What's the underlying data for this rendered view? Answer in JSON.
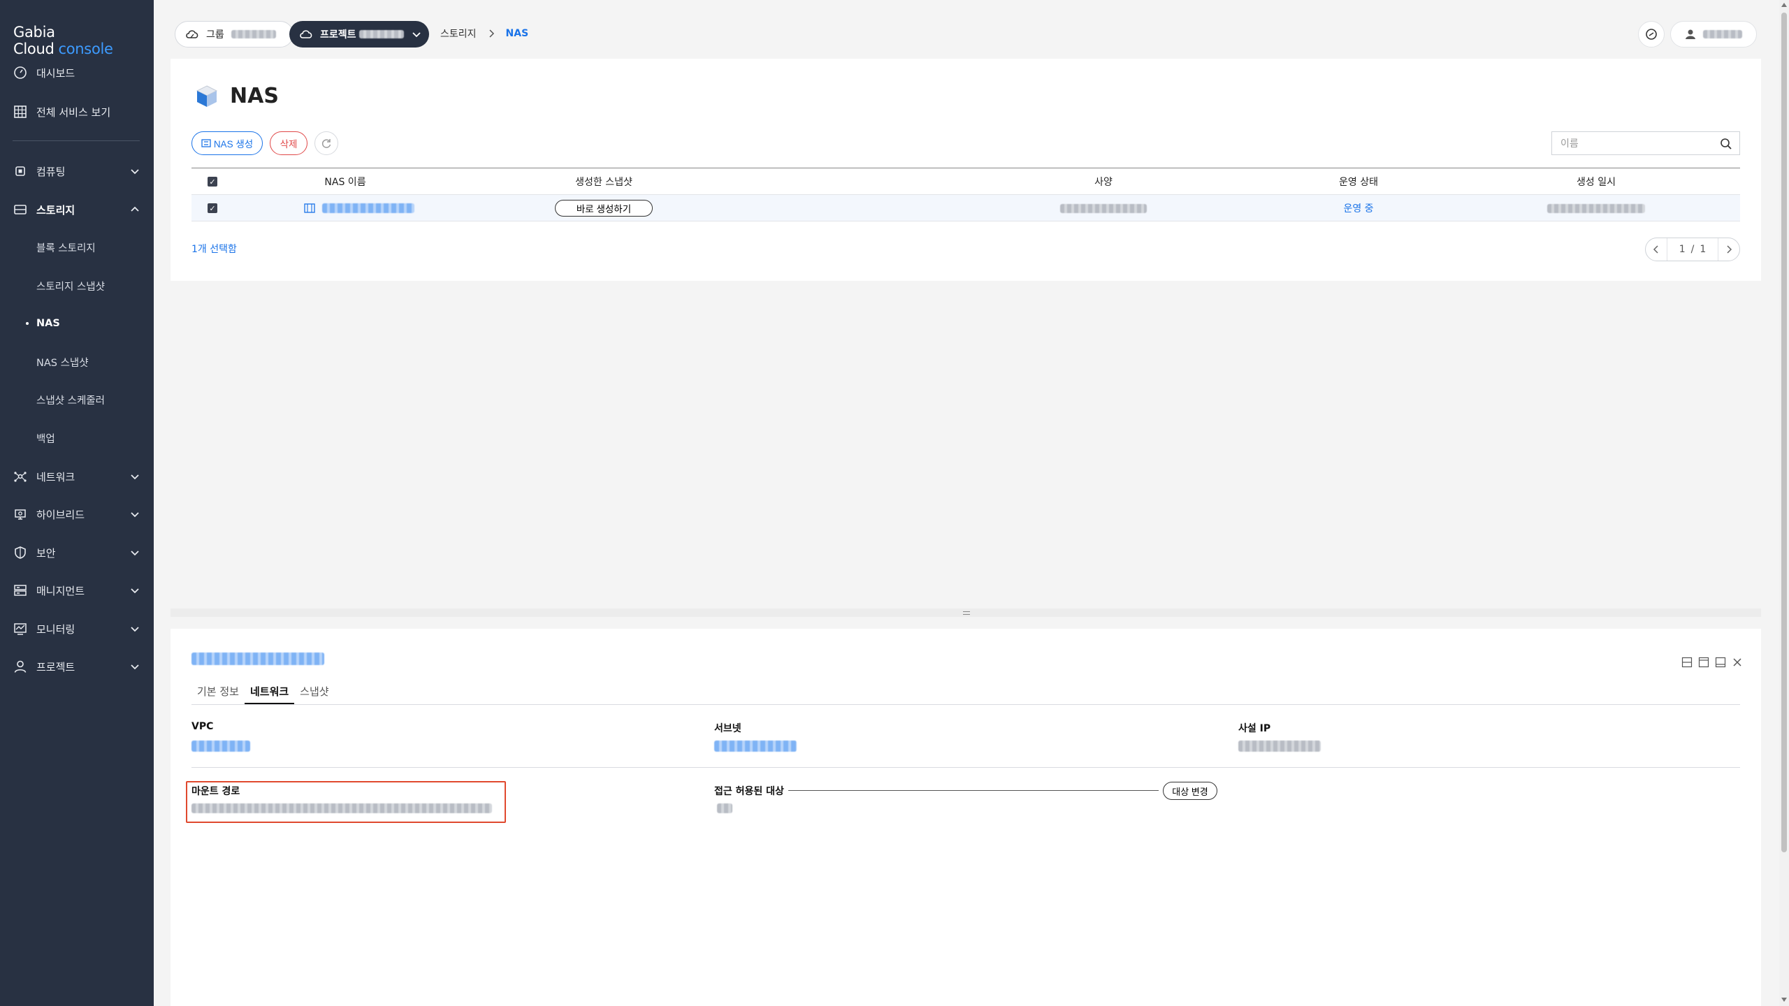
{
  "app": {
    "logo_brand": "Gabia Cloud",
    "logo_console": "console",
    "accent_color": "#1a73e8",
    "sidebar_bg": "#283142"
  },
  "sidebar": {
    "items": [
      {
        "label": "대시보드",
        "icon": "dashboard-icon"
      },
      {
        "label": "전체 서비스 보기",
        "icon": "grid-icon"
      },
      {
        "label": "컴퓨팅",
        "icon": "cpu-icon"
      },
      {
        "label": "스토리지",
        "icon": "storage-icon"
      },
      {
        "label": "네트워크",
        "icon": "network-icon"
      },
      {
        "label": "하이브리드",
        "icon": "hybrid-icon"
      },
      {
        "label": "보안",
        "icon": "shield-icon"
      },
      {
        "label": "매니지먼트",
        "icon": "management-icon"
      },
      {
        "label": "모니터링",
        "icon": "monitoring-icon"
      },
      {
        "label": "프로젝트",
        "icon": "user-icon"
      }
    ],
    "storage_sub": [
      {
        "label": "블록 스토리지"
      },
      {
        "label": "스토리지 스냅샷"
      },
      {
        "label": "NAS"
      },
      {
        "label": "NAS 스냅샷"
      },
      {
        "label": "스냅샷 스케줄러"
      },
      {
        "label": "백업"
      }
    ]
  },
  "topbar": {
    "group_label": "그룹",
    "project_label": "프로젝트",
    "breadcrumb": [
      "스토리지",
      "NAS"
    ]
  },
  "page": {
    "title": "NAS",
    "create_button": "NAS 생성",
    "delete_button": "삭제",
    "search_placeholder": "이름"
  },
  "table": {
    "headers": [
      "NAS 이름",
      "생성한 스냅샷",
      "사양",
      "운영 상태",
      "생성 일시"
    ],
    "rows": [
      {
        "snapshot_button": "바로 생성하기",
        "status": "운영 중"
      }
    ],
    "selected_count": "1개 선택함",
    "pager": {
      "current": "1",
      "separator": "/",
      "total": "1"
    }
  },
  "detail": {
    "tabs": [
      "기본 정보",
      "네트워크",
      "스냅샷"
    ],
    "active_tab": "네트워크",
    "fields": {
      "vpc_label": "VPC",
      "subnet_label": "서브넷",
      "private_ip_label": "사설 IP",
      "mount_path_label": "마운트 경로",
      "access_target_label": "접근 허용된 대상",
      "change_target_button": "대상 변경"
    }
  }
}
